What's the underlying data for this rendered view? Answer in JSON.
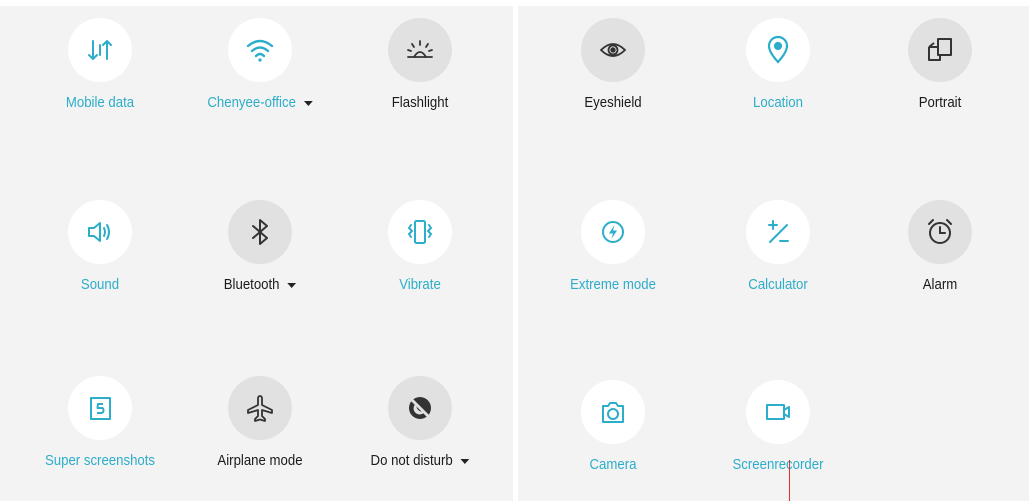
{
  "left_panel": {
    "tiles": [
      {
        "label": "Mobile data",
        "icon": "mobile-data-icon",
        "active": true
      },
      {
        "label": "Chenyee-office",
        "icon": "wifi-icon",
        "active": true,
        "has_dropdown": true
      },
      {
        "label": "Flashlight",
        "icon": "flashlight-icon",
        "active": false
      },
      {
        "label": "Sound",
        "icon": "sound-icon",
        "active": true
      },
      {
        "label": "Bluetooth",
        "icon": "bluetooth-icon",
        "active": false,
        "has_dropdown": true
      },
      {
        "label": "Vibrate",
        "icon": "vibrate-icon",
        "active": true
      },
      {
        "label": "Super screenshots",
        "icon": "super-screenshots-icon",
        "active": true
      },
      {
        "label": "Airplane mode",
        "icon": "airplane-icon",
        "active": false
      },
      {
        "label": "Do not disturb",
        "icon": "do-not-disturb-icon",
        "active": false,
        "has_dropdown": true
      }
    ]
  },
  "right_panel": {
    "tiles": [
      {
        "label": "Eyeshield",
        "icon": "eye-icon",
        "active": false
      },
      {
        "label": "Location",
        "icon": "location-pin-icon",
        "active": true
      },
      {
        "label": "Portrait",
        "icon": "rotate-portrait-icon",
        "active": false
      },
      {
        "label": "Extreme mode",
        "icon": "lightning-icon",
        "active": true
      },
      {
        "label": "Calculator",
        "icon": "calculator-icon",
        "active": true
      },
      {
        "label": "Alarm",
        "icon": "alarm-clock-icon",
        "active": false
      },
      {
        "label": "Camera",
        "icon": "camera-icon",
        "active": true
      },
      {
        "label": "Screenrecorder",
        "icon": "video-camera-icon",
        "active": true
      }
    ]
  },
  "colors": {
    "active_accent": "#2cadc9",
    "inactive_text": "#1a1a1a",
    "active_circle": "#ffffff",
    "inactive_circle": "#e1e1e1",
    "panel_background": "#f3f3f3",
    "marker": "#e03030"
  }
}
